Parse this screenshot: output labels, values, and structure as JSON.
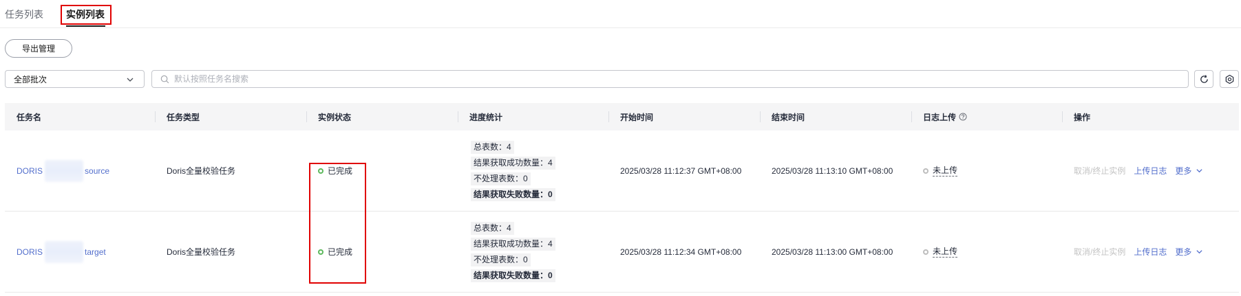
{
  "tabs": [
    {
      "label": "任务列表",
      "active": false
    },
    {
      "label": "实例列表",
      "active": true
    }
  ],
  "toolbar": {
    "export_label": "导出管理",
    "batch_filter": "全部批次",
    "search_placeholder": "默认按照任务名搜索"
  },
  "table": {
    "columns": [
      "任务名",
      "任务类型",
      "实例状态",
      "进度统计",
      "开始时间",
      "结束时间",
      "日志上传",
      "操作"
    ],
    "rows": [
      {
        "name_prefix": "DORIS",
        "name_suffix": "source",
        "type": "Doris全量校验任务",
        "status": "已完成",
        "progress": {
          "total_label": "总表数：",
          "total": 4,
          "success_label": "结果获取成功数量：",
          "success": 4,
          "skipped_label": "不处理表数：",
          "skipped": 0,
          "failed_label": "结果获取失败数量：",
          "failed": 0
        },
        "start_time": "2025/03/28 11:12:37 GMT+08:00",
        "end_time": "2025/03/28 11:13:10 GMT+08:00",
        "log_status": "未上传",
        "actions": {
          "cancel": "取消/终止实例",
          "upload_log": "上传日志",
          "more": "更多"
        }
      },
      {
        "name_prefix": "DORIS",
        "name_suffix": "target",
        "type": "Doris全量校验任务",
        "status": "已完成",
        "progress": {
          "total_label": "总表数：",
          "total": 4,
          "success_label": "结果获取成功数量：",
          "success": 4,
          "skipped_label": "不处理表数：",
          "skipped": 0,
          "failed_label": "结果获取失败数量：",
          "failed": 0
        },
        "start_time": "2025/03/28 11:12:34 GMT+08:00",
        "end_time": "2025/03/28 11:13:00 GMT+08:00",
        "log_status": "未上传",
        "actions": {
          "cancel": "取消/终止实例",
          "upload_log": "上传日志",
          "more": "更多"
        }
      }
    ]
  },
  "colors": {
    "link": "#526ecc",
    "status_done": "#5cb85c",
    "highlight": "#e00000",
    "disabled": "#c3c3c3"
  },
  "icons": {
    "batch_dropdown": "chevron-down-icon",
    "search": "search-icon",
    "refresh": "refresh-icon",
    "settings": "gear-icon",
    "log_help": "help-circle-icon",
    "status": "status-ring-icon",
    "more_actions": "chevron-down-icon"
  }
}
